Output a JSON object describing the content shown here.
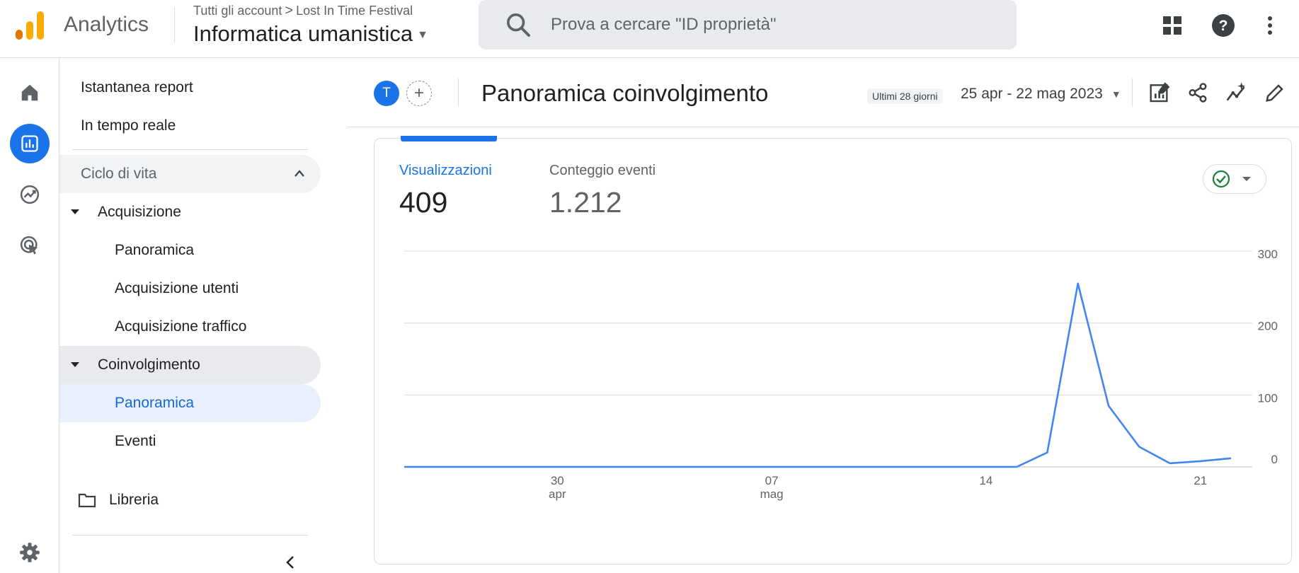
{
  "header": {
    "app_name": "Analytics",
    "breadcrumb": {
      "account": "Tutti gli account",
      "separator": ">",
      "property": "Lost In Time Festival"
    },
    "property_name": "Informatica umanistica",
    "search_placeholder": "Prova a cercare \"ID proprietà\""
  },
  "nav": {
    "items": [
      {
        "label": "Istantanea report"
      },
      {
        "label": "In tempo reale"
      },
      {
        "label": "Ciclo di vita"
      },
      {
        "label": "Acquisizione"
      },
      {
        "label": "Panoramica"
      },
      {
        "label": "Acquisizione utenti"
      },
      {
        "label": "Acquisizione traffico"
      },
      {
        "label": "Coinvolgimento"
      },
      {
        "label": "Panoramica"
      },
      {
        "label": "Eventi"
      },
      {
        "label": "Libreria"
      }
    ]
  },
  "main": {
    "compare_avatar": "T",
    "add_comparison": "+",
    "title": "Panoramica coinvolgimento",
    "date_chip": "Ultimi 28 giorni",
    "date_range": "25 apr - 22 mag 2023"
  },
  "card": {
    "metrics": [
      {
        "label": "Visualizzazioni",
        "value": "409",
        "active": true
      },
      {
        "label": "Conteggio eventi",
        "value": "1.212",
        "active": false
      }
    ]
  },
  "colors": {
    "accent": "#1a73e8",
    "line": "#4285f4",
    "logo_orange": "#f9ab00",
    "logo_dark": "#e37400"
  },
  "chart_data": {
    "type": "line",
    "series": [
      {
        "values": [
          0,
          0,
          0,
          0,
          0,
          0,
          0,
          0,
          0,
          0,
          0,
          0,
          0,
          0,
          0,
          0,
          0,
          0,
          0,
          0,
          0,
          20,
          255,
          85,
          28,
          5,
          8,
          12
        ]
      }
    ],
    "x_ticks": [
      {
        "index": 5,
        "label": "30",
        "sublabel": "apr"
      },
      {
        "index": 12,
        "label": "07",
        "sublabel": "mag"
      },
      {
        "index": 19,
        "label": "14",
        "sublabel": ""
      },
      {
        "index": 26,
        "label": "21",
        "sublabel": ""
      }
    ],
    "y_ticks": [
      "0",
      "100",
      "200",
      "300"
    ],
    "ylim": [
      0,
      300
    ],
    "grid": true
  }
}
